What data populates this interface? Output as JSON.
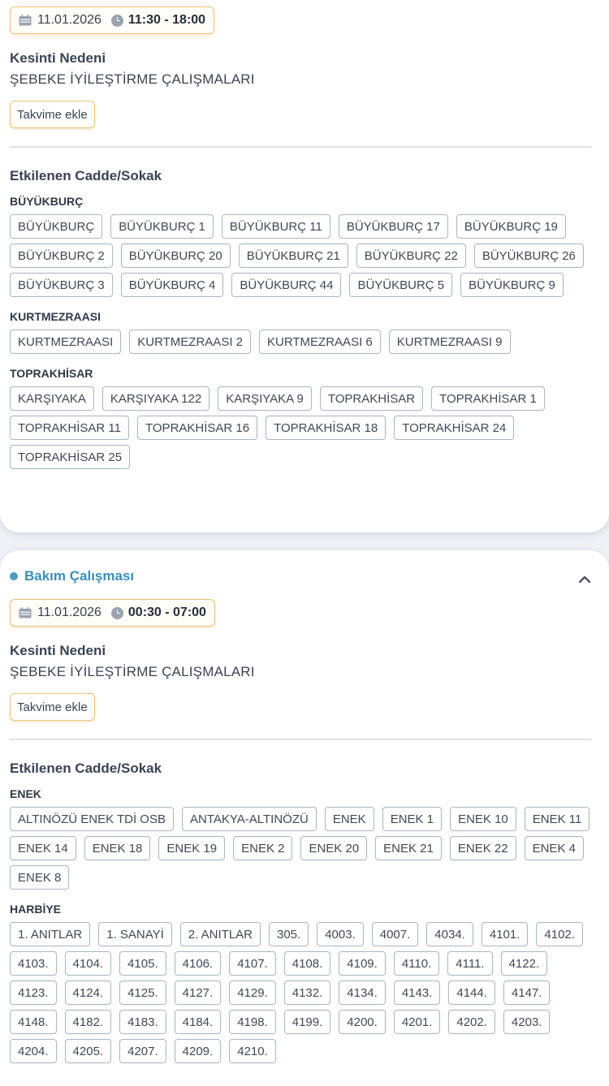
{
  "colors": {
    "accent_orange": "#f0c173",
    "status_dot": "#4a9ec3",
    "title_blue": "#3a8fb8"
  },
  "outages": [
    {
      "date": "11.01.2026",
      "time": "11:30 - 18:00",
      "reason_title": "Kesinti Nedeni",
      "reason": "ŞEBEKE İYİLEŞTİRME ÇALIŞMALARI",
      "calendar_button": "Takvime ekle",
      "streets_title": "Etkilenen Cadde/Sokak",
      "groups": [
        {
          "name": "BÜYÜKBURÇ",
          "streets": [
            "BÜYÜKBURÇ",
            "BÜYÜKBURÇ 1",
            "BÜYÜKBURÇ 11",
            "BÜYÜKBURÇ 17",
            "BÜYÜKBURÇ 19",
            "BÜYÜKBURÇ 2",
            "BÜYÜKBURÇ 20",
            "BÜYÜKBURÇ 21",
            "BÜYÜKBURÇ 22",
            "BÜYÜKBURÇ 26",
            "BÜYÜKBURÇ 3",
            "BÜYÜKBURÇ 4",
            "BÜYÜKBURÇ 44",
            "BÜYÜKBURÇ 5",
            "BÜYÜKBURÇ 9"
          ]
        },
        {
          "name": "KURTMEZRAASI",
          "streets": [
            "KURTMEZRAASI",
            "KURTMEZRAASI 2",
            "KURTMEZRAASI 6",
            "KURTMEZRAASI 9"
          ]
        },
        {
          "name": "TOPRAKHİSAR",
          "streets": [
            "KARŞIYAKA",
            "KARŞIYAKA 122",
            "KARŞIYAKA 9",
            "TOPRAKHİSAR",
            "TOPRAKHİSAR 1",
            "TOPRAKHİSAR 11",
            "TOPRAKHİSAR 16",
            "TOPRAKHİSAR 18",
            "TOPRAKHİSAR 24",
            "TOPRAKHİSAR 25"
          ]
        }
      ]
    },
    {
      "status": "Bakım Çalışması",
      "date": "11.01.2026",
      "time": "00:30 - 07:00",
      "reason_title": "Kesinti Nedeni",
      "reason": "ŞEBEKE İYİLEŞTİRME ÇALIŞMALARI",
      "calendar_button": "Takvime ekle",
      "streets_title": "Etkilenen Cadde/Sokak",
      "groups": [
        {
          "name": "ENEK",
          "streets": [
            "ALTINÖZÜ ENEK TDİ OSB",
            "ANTAKYA-ALTINÖZÜ",
            "ENEK",
            "ENEK 1",
            "ENEK 10",
            "ENEK 11",
            "ENEK 14",
            "ENEK 18",
            "ENEK 19",
            "ENEK 2",
            "ENEK 20",
            "ENEK 21",
            "ENEK 22",
            "ENEK 4",
            "ENEK 8"
          ]
        },
        {
          "name": "HARBİYE",
          "streets": [
            "1. ANITLAR",
            "1. SANAYİ",
            "2. ANITLAR",
            "305.",
            "4003.",
            "4007.",
            "4034.",
            "4101.",
            "4102.",
            "4103.",
            "4104.",
            "4105.",
            "4106.",
            "4107.",
            "4108.",
            "4109.",
            "4110.",
            "4111.",
            "4122.",
            "4123.",
            "4124.",
            "4125.",
            "4127.",
            "4129.",
            "4132.",
            "4134.",
            "4143.",
            "4144.",
            "4147.",
            "4148.",
            "4182.",
            "4183.",
            "4184.",
            "4198.",
            "4199.",
            "4200.",
            "4201.",
            "4202.",
            "4203.",
            "4204.",
            "4205.",
            "4207.",
            "4209.",
            "4210."
          ]
        }
      ]
    }
  ]
}
